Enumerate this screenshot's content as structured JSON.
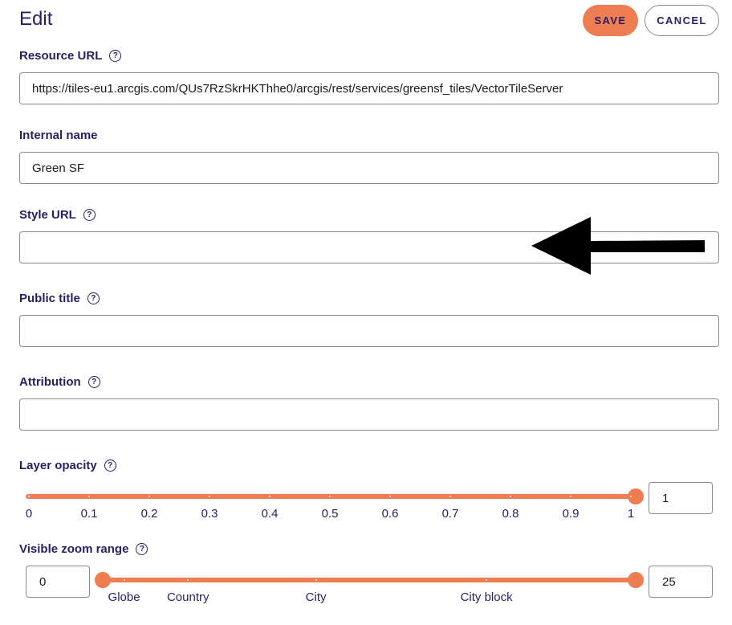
{
  "header": {
    "title": "Edit",
    "save_label": "SAVE",
    "cancel_label": "CANCEL"
  },
  "fields": {
    "resource_url": {
      "label": "Resource URL",
      "value": "https://tiles-eu1.arcgis.com/QUs7RzSkrHKThhe0/arcgis/rest/services/greensf_tiles/VectorTileServer"
    },
    "internal_name": {
      "label": "Internal name",
      "value": "Green SF"
    },
    "style_url": {
      "label": "Style URL",
      "value": ""
    },
    "public_title": {
      "label": "Public title",
      "value": ""
    },
    "attribution": {
      "label": "Attribution",
      "value": ""
    }
  },
  "help_glyph": "?",
  "opacity": {
    "label": "Layer opacity",
    "value": "1",
    "level": 1,
    "ticks": [
      "0",
      "0.1",
      "0.2",
      "0.3",
      "0.4",
      "0.5",
      "0.6",
      "0.7",
      "0.8",
      "0.9",
      "1"
    ]
  },
  "zoom": {
    "label": "Visible zoom range",
    "min_value": "0",
    "max_value": "25",
    "range": [
      0,
      25
    ],
    "marks": [
      {
        "label": "Globe",
        "zoom": 1
      },
      {
        "label": "Country",
        "zoom": 4
      },
      {
        "label": "City",
        "zoom": 10
      },
      {
        "label": "City block",
        "zoom": 18
      }
    ]
  },
  "colors": {
    "accent": "#ee7d52",
    "text": "#2a1d63",
    "border": "#8c8a94"
  },
  "icons": {
    "help": "help-circle-icon",
    "annotation": "arrow-left-icon"
  }
}
